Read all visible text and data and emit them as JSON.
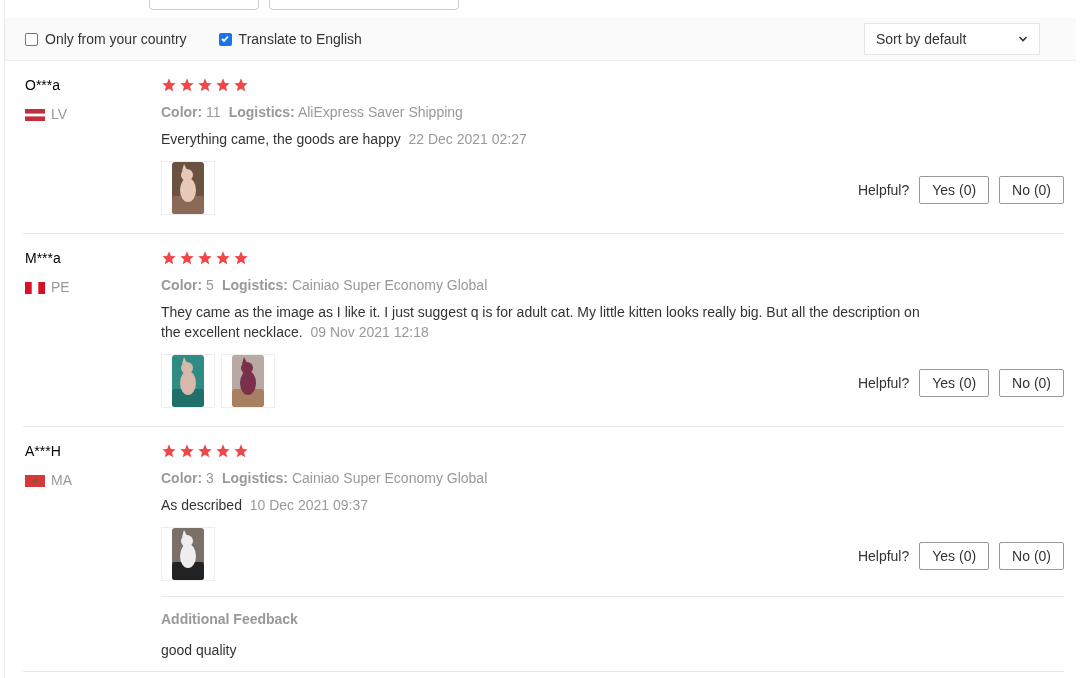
{
  "filters": [
    {
      "label": "Only from your country",
      "checked": false
    },
    {
      "label": "Translate to English",
      "checked": true
    }
  ],
  "sort": {
    "value": "Sort by default"
  },
  "reviews": [
    {
      "name": "O***a",
      "flag": {
        "kind": "lv"
      },
      "country": "LV",
      "stars": 5,
      "color_label": "Color:",
      "product_color": "11",
      "logistics_label": "Logistics:",
      "logistics": "AliExpress Saver Shipping",
      "text": "Everything came, the goods are happy",
      "date": "22 Dec 2021 02:27",
      "photos": [
        {
          "kind": "picture"
        }
      ],
      "helpful": "Helpful?",
      "yes": "Yes (0)",
      "no": "No (0)"
    },
    {
      "name": "M***a",
      "flag": {
        "kind": "pe"
      },
      "country": "PE",
      "stars": 5,
      "color_label": "Color:",
      "product_color": "5",
      "logistics_label": "Logistics:",
      "logistics": "Cainiao Super Economy Global",
      "text": "They came as the image as I like it. I just suggest q is for adult cat. My little kitten looks really big. But all the description on the excellent necklace.",
      "date": "09 Nov 2021 12:18",
      "photos": [
        {
          "kind": "picture"
        },
        {
          "kind": "picture"
        }
      ],
      "helpful": "Helpful?",
      "yes": "Yes (0)",
      "no": "No (0)"
    },
    {
      "name": "A***H",
      "flag": {
        "kind": "ma"
      },
      "country": "MA",
      "stars": 5,
      "color_label": "Color:",
      "product_color": "3",
      "logistics_label": "Logistics:",
      "logistics": "Cainiao Super Economy Global",
      "text": "As described",
      "date": "10 Dec 2021 09:37",
      "photos": [
        {
          "kind": "picture"
        }
      ],
      "helpful": "Helpful?",
      "yes": "Yes (0)",
      "no": "No (0)",
      "additional": {
        "title": "Additional Feedback",
        "text": "good quality"
      }
    }
  ]
}
